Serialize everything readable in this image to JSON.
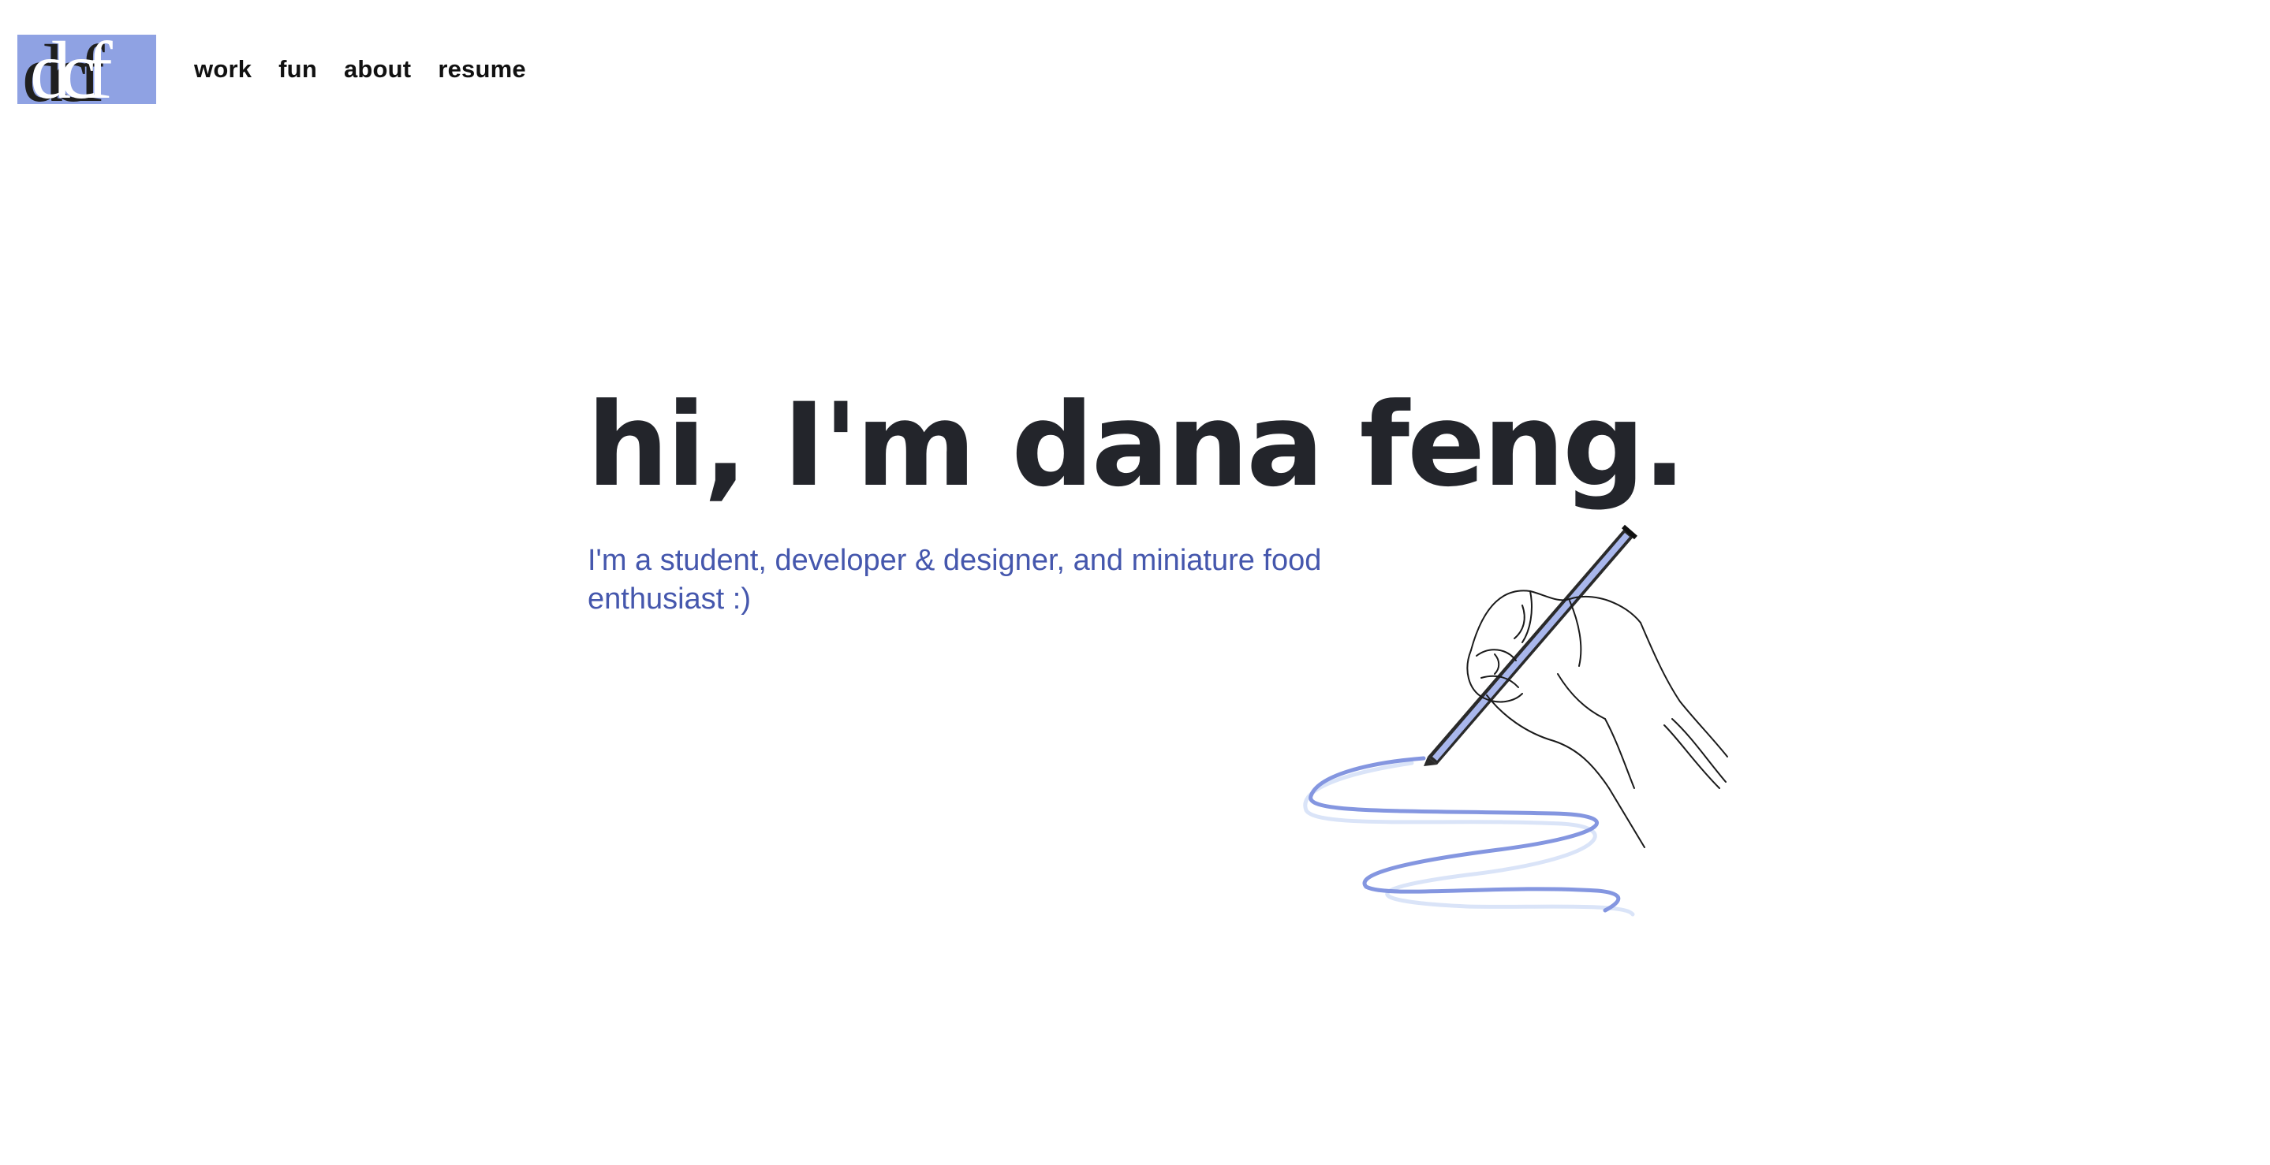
{
  "logo": {
    "text": "dcf",
    "background_color": "#8fa2e3"
  },
  "nav": {
    "items": [
      {
        "label": "work"
      },
      {
        "label": "fun"
      },
      {
        "label": "about"
      },
      {
        "label": "resume"
      }
    ]
  },
  "hero": {
    "title": "hi, I'm dana feng.",
    "subtitle": "I'm a student, developer & designer, and miniature food enthusiast :)",
    "title_color": "#23252b",
    "subtitle_color": "#4557ad"
  },
  "illustration": {
    "icon": "hand-drawing-pen-icon",
    "line_color": "#8496e0",
    "line_shadow_color": "#d6e1f7"
  }
}
